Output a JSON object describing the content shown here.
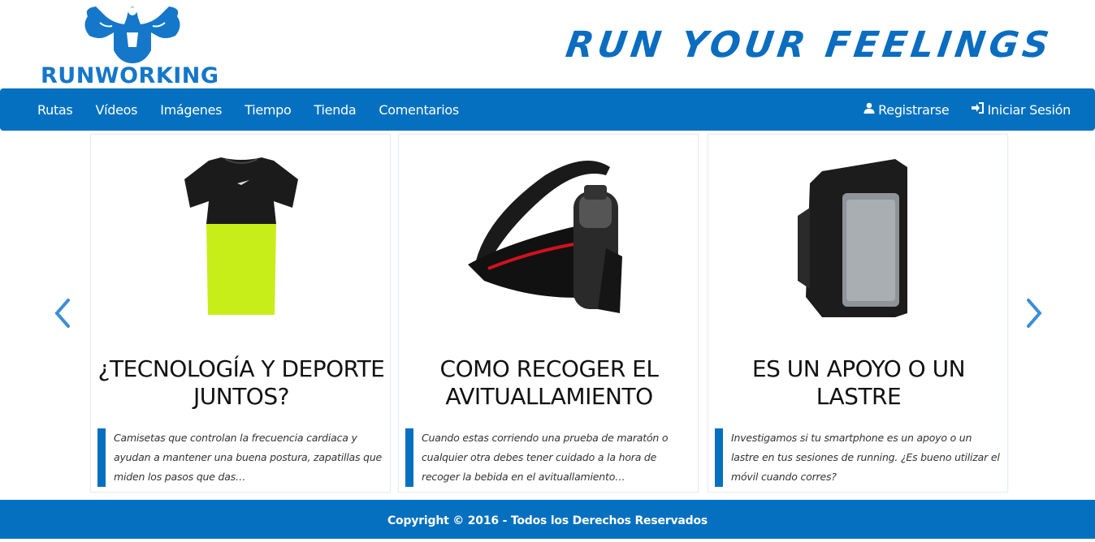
{
  "brand": {
    "logo_text": "RUNWORKING",
    "tagline": "RUN YOUR FEELINGS",
    "accent": "#0470bf"
  },
  "nav": {
    "left": [
      {
        "label": "Rutas"
      },
      {
        "label": "Vídeos"
      },
      {
        "label": "Imágenes"
      },
      {
        "label": "Tiempo"
      },
      {
        "label": "Tienda"
      },
      {
        "label": "Comentarios"
      }
    ],
    "register": {
      "label": "Registrarse",
      "icon": "user-icon"
    },
    "login": {
      "label": "Iniciar Sesión",
      "icon": "log-in-icon"
    }
  },
  "carousel": {
    "prev_icon": "chevron-left-icon",
    "next_icon": "chevron-right-icon",
    "cards": [
      {
        "title": "¿TECNOLOGÍA Y DEPORTE JUNTOS?",
        "text": "Camisetas que controlan la frecuencia cardiaca y ayudan a mantener una buena postura, zapatillas que miden los pasos que das…"
      },
      {
        "title": "COMO RECOGER EL AVITUALLAMIENTO",
        "text": "Cuando estas corriendo una prueba de maratón o cualquier otra debes tener cuidado a la hora de recoger la bebida en el avituallamiento…"
      },
      {
        "title": "ES UN APOYO O UN LASTRE",
        "text": "Investigamos si tu smartphone es un apoyo o un lastre en tus sesiones de running. ¿Es bueno utilizar el móvil cuando corres?"
      }
    ]
  },
  "footer": {
    "copyright": "Copyright © 2016 - Todos los Derechos Reservados"
  }
}
